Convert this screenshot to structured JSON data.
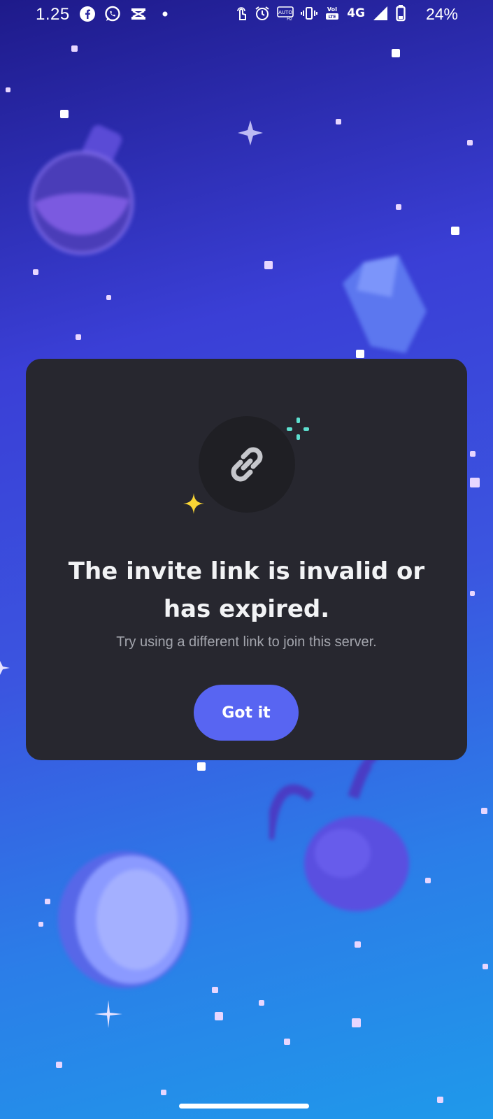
{
  "status_bar": {
    "time": "1.25",
    "battery": "24%",
    "network": "4G",
    "icons_left": [
      "facebook-icon",
      "whatsapp-icon",
      "capcut-icon",
      "dot-icon"
    ],
    "icons_right": [
      "touch-icon",
      "alarm-icon",
      "auto-hd-icon",
      "vibrate-icon",
      "volte-icon",
      "signal-icon",
      "battery-icon"
    ]
  },
  "dialog": {
    "icon": "link-icon",
    "title": "The invite link is invalid or has expired.",
    "subtitle": "Try using a different link to join this server.",
    "button_label": "Got it"
  },
  "colors": {
    "dialog_bg": "#27272f",
    "button": "#5865f2",
    "title": "#f2f3f5",
    "subtitle": "#a3a5ad",
    "sparkle_yellow": "#f9d535",
    "sparkle_teal": "#5ee0d0"
  }
}
